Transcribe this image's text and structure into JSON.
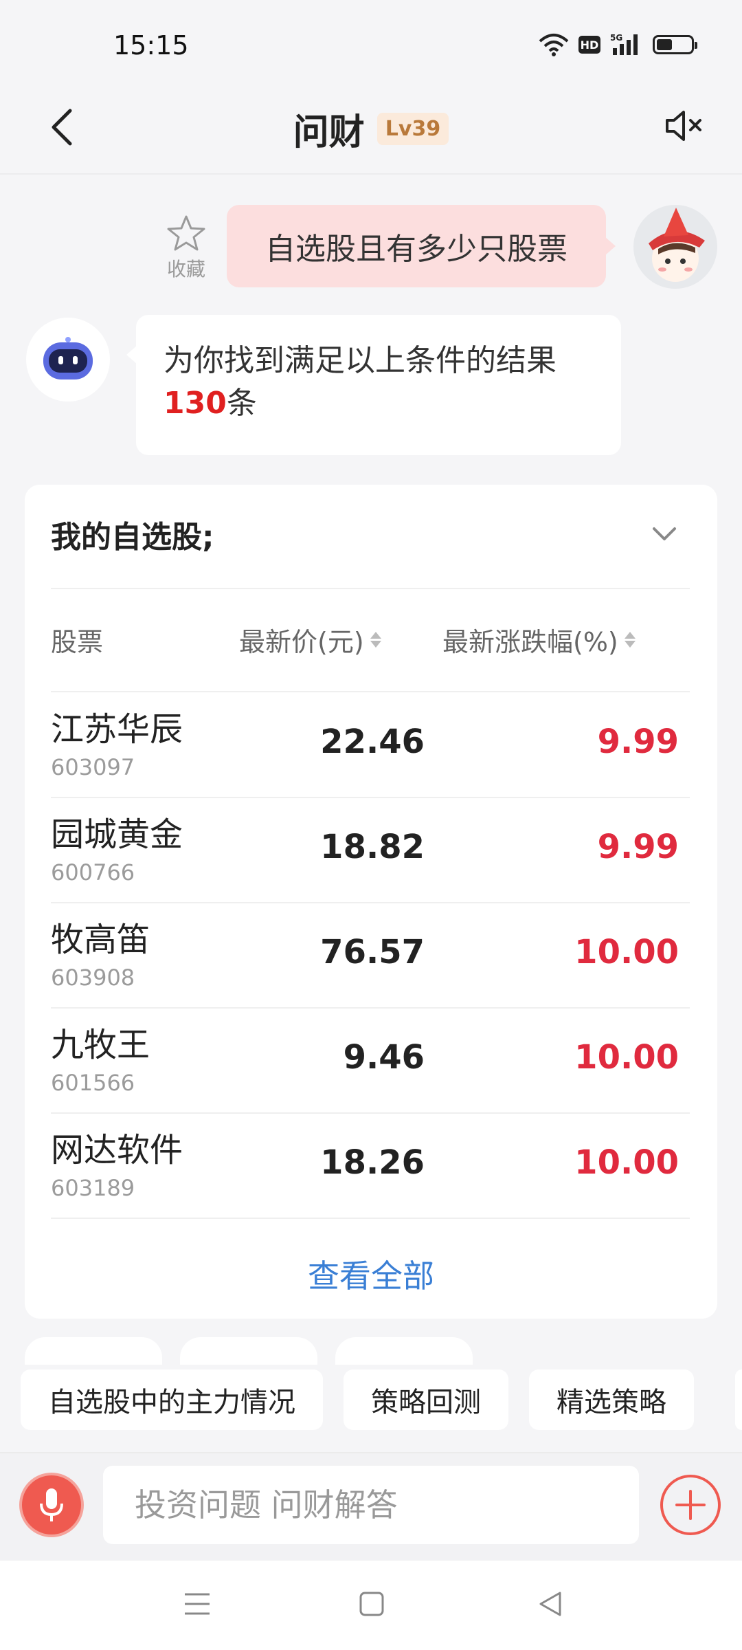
{
  "status_bar": {
    "time": "15:15",
    "hd_label": "HD",
    "network_label": "5G",
    "battery_level": 0.45,
    "icons": [
      "wifi-icon",
      "hd-icon",
      "signal-icon",
      "battery-icon"
    ]
  },
  "header": {
    "title": "问财",
    "level": "Lv39",
    "back_icon": "chevron-left-icon",
    "mute_icon": "speaker-mute-icon"
  },
  "chat": {
    "favorite_label": "收藏",
    "user_message": "自选股且有多少只股票",
    "bot_message_prefix": "为你找到满足以上条件的结果",
    "bot_message_count": "130",
    "bot_message_suffix": "条"
  },
  "result_card": {
    "title": "我的自选股;",
    "columns": {
      "stock": "股票",
      "price": "最新价(元)",
      "change": "最新涨跌幅(%)"
    },
    "rows": [
      {
        "name": "江苏华辰",
        "code": "603097",
        "price": "22.46",
        "change": "9.99"
      },
      {
        "name": "园城黄金",
        "code": "600766",
        "price": "18.82",
        "change": "9.99"
      },
      {
        "name": "牧高笛",
        "code": "603908",
        "price": "76.57",
        "change": "10.00"
      },
      {
        "name": "九牧王",
        "code": "601566",
        "price": "9.46",
        "change": "10.00"
      },
      {
        "name": "网达软件",
        "code": "603189",
        "price": "18.26",
        "change": "10.00"
      }
    ],
    "view_all_label": "查看全部"
  },
  "suggestions": [
    "自选股中的主力情况",
    "策略回测",
    "精选策略"
  ],
  "input_bar": {
    "placeholder": "投资问题 问财解答"
  },
  "colors": {
    "up_red": "#e02a3e",
    "accent_blue": "#3a7fd5",
    "user_bubble": "#fcdede",
    "mic_red": "#ef5a50"
  }
}
